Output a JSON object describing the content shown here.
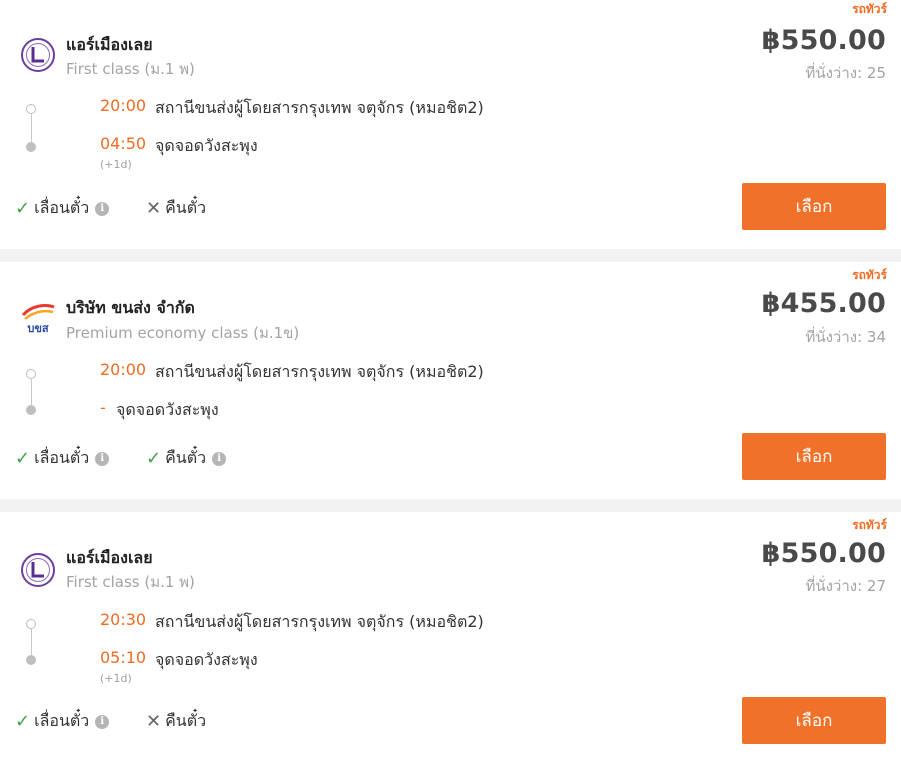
{
  "accent_color": "#f07129",
  "cards": [
    {
      "tag": "รถทัวร์",
      "operator": "แอร์เมืองเลย",
      "class": "First class (ม.1 พ)",
      "logo": "air-muangloei-logo",
      "price": "฿550.00",
      "seats": "ที่นั่งว่าง: 25",
      "depart_time": "20:00",
      "depart_station": "สถานีขนส่งผู้โดยสารกรุงเทพ จตุจักร (หมอชิต2)",
      "arrive_time": "04:50",
      "arrive_station": "จุดจอดวังสะพุง",
      "next_day": "(+1d)",
      "policy_change": "เลื่อนตั๋ว",
      "policy_refund": "คืนตั๋ว",
      "button": "เลือก"
    },
    {
      "tag": "รถทัวร์",
      "operator": "บริษัท ขนส่ง จำกัด",
      "class": "Premium economy class (ม.1ข)",
      "logo": "bks-logo",
      "logo_text": "บขส",
      "price": "฿455.00",
      "seats": "ที่นั่งว่าง: 34",
      "depart_time": "20:00",
      "depart_station": "สถานีขนส่งผู้โดยสารกรุงเทพ จตุจักร (หมอชิต2)",
      "arrive_time": "-",
      "arrive_station": "จุดจอดวังสะพุง",
      "policy_change": "เลื่อนตั๋ว",
      "policy_refund": "คืนตั๋ว",
      "button": "เลือก"
    },
    {
      "tag": "รถทัวร์",
      "operator": "แอร์เมืองเลย",
      "class": "First class (ม.1 พ)",
      "logo": "air-muangloei-logo",
      "price": "฿550.00",
      "seats": "ที่นั่งว่าง: 27",
      "depart_time": "20:30",
      "depart_station": "สถานีขนส่งผู้โดยสารกรุงเทพ จตุจักร (หมอชิต2)",
      "arrive_time": "05:10",
      "arrive_station": "จุดจอดวังสะพุง",
      "next_day": "(+1d)",
      "policy_change": "เลื่อนตั๋ว",
      "policy_refund": "คืนตั๋ว",
      "button": "เลือก"
    }
  ]
}
